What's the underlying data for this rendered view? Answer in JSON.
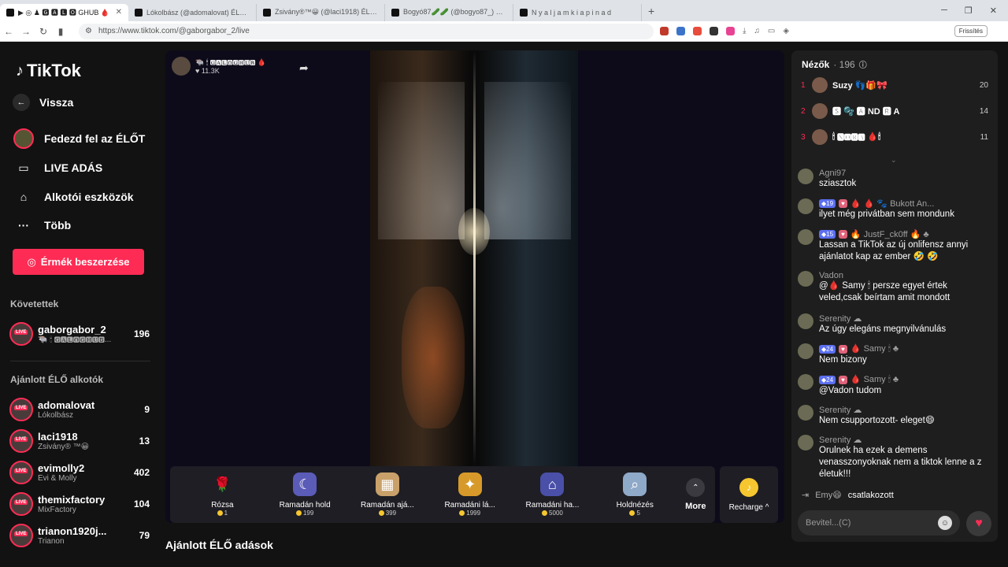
{
  "browser": {
    "tabs": [
      {
        "title": "▶ ◎ ♟ 🅶 🅰 🅻 🅾 GHUB 🩸"
      },
      {
        "title": "Lókolbász (@adomalovat) ÉLŐ adásb"
      },
      {
        "title": "Zsivány®™😀 (@laci1918) ÉLŐ adás"
      },
      {
        "title": "Bogyó87🥒🥒 (@bogyo87_) ÉLŐ a"
      },
      {
        "title": "N y a l j a m k i a p i n a d"
      }
    ],
    "url": "https://www.tiktok.com/@gaborgabor_2/live",
    "refresh_label": "Frissítés"
  },
  "sidebar": {
    "logo": "TikTok",
    "back": "Vissza",
    "nav": [
      {
        "label": "Fedezd fel az ÉLŐT"
      },
      {
        "label": "LIVE ADÁS"
      },
      {
        "label": "Alkotói eszközök"
      },
      {
        "label": "Több"
      }
    ],
    "coins_button": "Érmék beszerzése",
    "following_title": "Követettek",
    "following": [
      {
        "name": "gaborgabor_2",
        "sub": "🐃 🕯 🅶🅰🅻🅾🅶🅷🆄🅱...",
        "count": "196"
      }
    ],
    "recommended_title": "Ajánlott ÉLŐ alkotók",
    "recommended": [
      {
        "name": "adomalovat",
        "sub": "Lókolbász",
        "count": "9"
      },
      {
        "name": "laci1918",
        "sub": "Zsivány® ™😀",
        "count": "13"
      },
      {
        "name": "evimolly2",
        "sub": "Évi & Molly",
        "count": "402"
      },
      {
        "name": "themixfactory",
        "sub": "MixFactory",
        "count": "104"
      },
      {
        "name": "trianon1920j...",
        "sub": "Trianon",
        "count": "79"
      }
    ]
  },
  "stream": {
    "host_name": "🐃 🕯 🅶🅰🅻🅾🅶🅷🆄🅱 🩸",
    "likes": "11.3K",
    "gifts": [
      {
        "name": "Rózsa",
        "price": "1",
        "icon": "rose-icon"
      },
      {
        "name": "Ramadán hold",
        "price": "199",
        "icon": "moon-icon"
      },
      {
        "name": "Ramadán ajá...",
        "price": "399",
        "icon": "giftbox-icon"
      },
      {
        "name": "Ramadáni lá...",
        "price": "1999",
        "icon": "lantern-icon"
      },
      {
        "name": "Ramadáni ha...",
        "price": "5000",
        "icon": "mosque-icon"
      },
      {
        "name": "Holdnézés",
        "price": "5",
        "icon": "telescope-icon"
      }
    ],
    "more_label": "More",
    "recharge_label": "Recharge ^"
  },
  "recommended_streams_title": "Ajánlott ÉLŐ adások",
  "viewers": {
    "title": "Nézők",
    "count": "· 196",
    "top": [
      {
        "rank": "1",
        "name": "Suzy 👣🎁🎀",
        "score": "20"
      },
      {
        "rank": "2",
        "name": "🆂 🫧 🅰 ND 🆁 A",
        "score": "14"
      },
      {
        "rank": "3",
        "name": "🕯 🅽🅾🆁🅰 🩸🕯",
        "score": "11"
      }
    ]
  },
  "chat": [
    {
      "name": "Agni97",
      "badges": [],
      "text": "sziasztok"
    },
    {
      "name": "🩸 🩸 🐾 Bukott An...",
      "badges": [
        "19"
      ],
      "text": "ilyet még privátban sem mondunk"
    },
    {
      "name": "🔥 JustF_ck0ff 🔥 ♣",
      "badges": [
        "15"
      ],
      "text": "Lassan a TikTok az új onlifensz annyi ajánlatot kap az ember 🤣 🤣"
    },
    {
      "name": "Vadon",
      "badges": [],
      "text": "@🩸 Samy 🕯 persze egyet értek veled,csak beírtam amit mondott"
    },
    {
      "name": "Serenity ☁",
      "badges": [],
      "text": "Az úgy elegáns megnyilvánulás"
    },
    {
      "name": "🩸 Samy 🕯 ♣",
      "badges": [
        "24"
      ],
      "text": "Nem bizony"
    },
    {
      "name": "🩸 Samy 🕯 ♣",
      "badges": [
        "24"
      ],
      "text": "@Vadon tudom"
    },
    {
      "name": "Serenity ☁",
      "badges": [],
      "text": "Nem csupportozott- eleget😄"
    },
    {
      "name": "Serenity ☁",
      "badges": [],
      "text": "Orulnek ha ezek a demens venasszonyoknak nem a tiktok lenne a z életuk!!!"
    }
  ],
  "joined": {
    "name": "Emy😄",
    "text": "csatlakozott"
  },
  "input_placeholder": "Bevitel...(C)"
}
